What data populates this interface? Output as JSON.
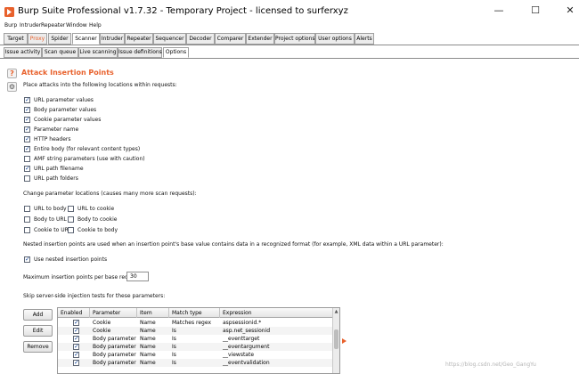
{
  "window": {
    "title": "Burp Suite Professional v1.7.32 - Temporary Project - licensed to surferxyz",
    "minimize": "—",
    "maximize": "☐",
    "close": "✕"
  },
  "menu": [
    "Burp",
    "Intruder",
    "Repeater",
    "Window",
    "Help"
  ],
  "main_tabs": [
    "Target",
    "Proxy",
    "Spider",
    "Scanner",
    "Intruder",
    "Repeater",
    "Sequencer",
    "Decoder",
    "Comparer",
    "Extender",
    "Project options",
    "User options",
    "Alerts"
  ],
  "main_tabs_active": "Scanner",
  "main_tabs_highlight": "Proxy",
  "sub_tabs": [
    "Issue activity",
    "Scan queue",
    "Live scanning",
    "Issue definitions",
    "Options"
  ],
  "sub_tabs_active": "Options",
  "side_icons": [
    "help-icon",
    "settings-icon"
  ],
  "section": {
    "title": "Attack Insertion Points",
    "intro": "Place attacks into the following locations within requests:",
    "locations": [
      {
        "label": "URL parameter values",
        "checked": true
      },
      {
        "label": "Body parameter values",
        "checked": true
      },
      {
        "label": "Cookie parameter values",
        "checked": true
      },
      {
        "label": "Parameter name",
        "checked": true
      },
      {
        "label": "HTTP headers",
        "checked": true
      },
      {
        "label": "Entire body (for relevant content types)",
        "checked": true
      },
      {
        "label": "AMF string parameters (use with caution)",
        "checked": false
      },
      {
        "label": "URL path filename",
        "checked": true
      },
      {
        "label": "URL path folders",
        "checked": false
      }
    ],
    "change_heading": "Change parameter locations (causes many more scan requests):",
    "change_options": [
      {
        "label": "URL to body",
        "checked": false
      },
      {
        "label": "URL to cookie",
        "checked": false
      },
      {
        "label": "Body to URL",
        "checked": false
      },
      {
        "label": "Body to cookie",
        "checked": false
      },
      {
        "label": "Cookie to URL",
        "checked": false
      },
      {
        "label": "Cookie to body",
        "checked": false
      }
    ],
    "nested_text": "Nested insertion points are used when an insertion point's base value contains data in a recognized format (for example, XML data within a URL parameter):",
    "nested_option": {
      "label": "Use nested insertion points",
      "checked": true
    },
    "max_label": "Maximum insertion points per base request:",
    "max_value": "30",
    "skip_heading": "Skip server-side injection tests for these parameters:"
  },
  "buttons": {
    "add": "Add",
    "edit": "Edit",
    "remove": "Remove"
  },
  "table": {
    "headers": [
      "Enabled",
      "Parameter",
      "Item",
      "Match type",
      "Expression"
    ],
    "rows": [
      {
        "enabled": true,
        "parameter": "Cookie",
        "item": "Name",
        "match": "Matches regex",
        "expression": "aspsessionid.*"
      },
      {
        "enabled": true,
        "parameter": "Cookie",
        "item": "Name",
        "match": "Is",
        "expression": "asp.net_sessionid"
      },
      {
        "enabled": true,
        "parameter": "Body parameter",
        "item": "Name",
        "match": "Is",
        "expression": "__eventtarget"
      },
      {
        "enabled": true,
        "parameter": "Body parameter",
        "item": "Name",
        "match": "Is",
        "expression": "__eventargument"
      },
      {
        "enabled": true,
        "parameter": "Body parameter",
        "item": "Name",
        "match": "Is",
        "expression": "__viewstate"
      },
      {
        "enabled": true,
        "parameter": "Body parameter",
        "item": "Name",
        "match": "Is",
        "expression": "__eventvalidation"
      }
    ]
  },
  "watermark": "https://blog.csdn.net/Geo_GangYu",
  "colors": {
    "accent": "#e8612c",
    "checkbox_tick": "#1f4f9e"
  }
}
